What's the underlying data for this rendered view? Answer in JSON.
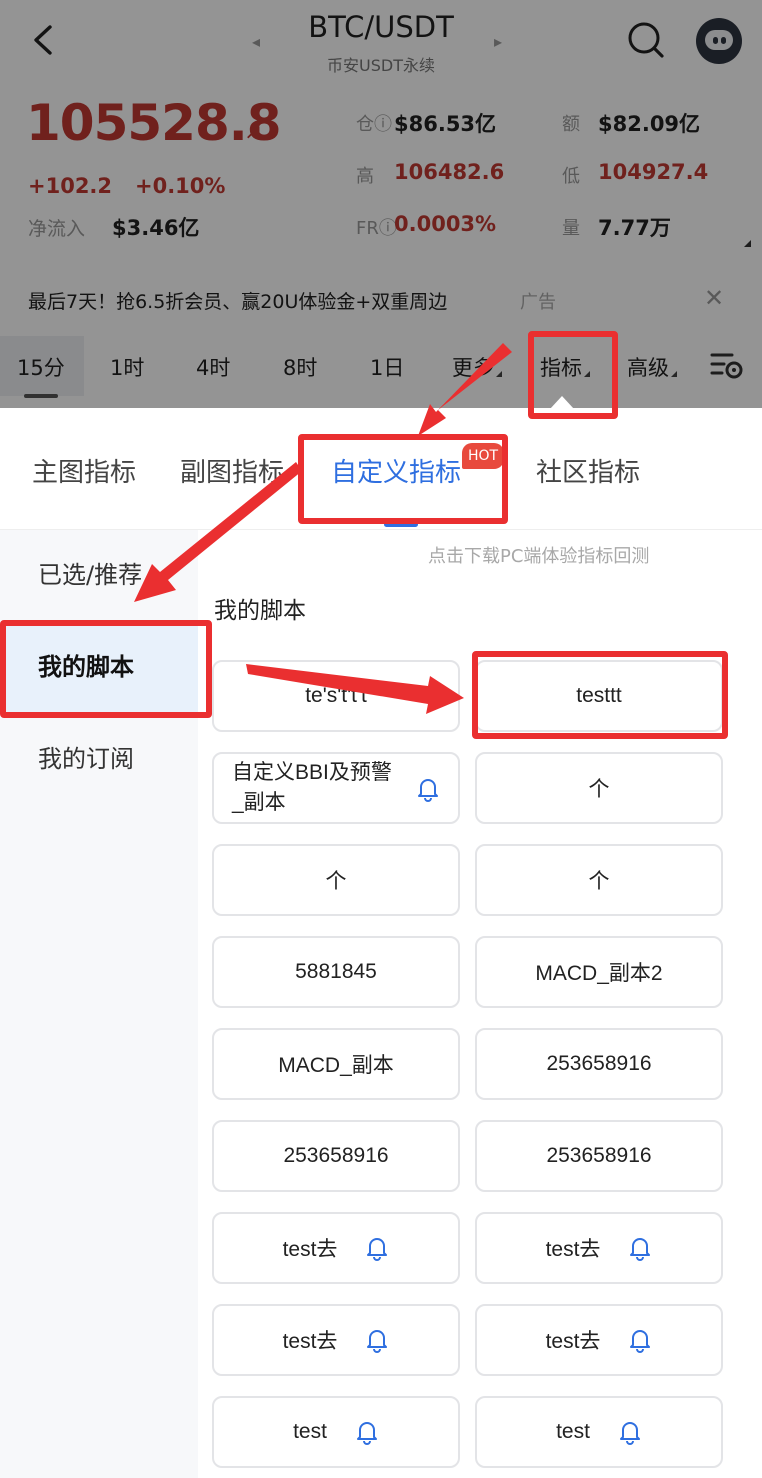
{
  "header": {
    "pair": "BTC/USDT",
    "subtitle": "币安USDT永续",
    "prev_arrow": "◂",
    "next_arrow": "▸"
  },
  "price": {
    "last": "105528.8",
    "arrow": "↗",
    "change_abs": "+102.2",
    "change_pct": "+0.10%",
    "netflow_label": "净流入",
    "netflow_value": "$3.46亿"
  },
  "stats": {
    "oi_label": "仓ⓘ",
    "oi_value": "$86.53亿",
    "vol_amt_label": "额",
    "vol_amt_value": "$82.09亿",
    "high_label": "高",
    "high_value": "106482.6",
    "low_label": "低",
    "low_value": "104927.4",
    "fr_label": "FRⓘ",
    "fr_value": "0.0003%",
    "qty_label": "量",
    "qty_value": "7.77万"
  },
  "ad": {
    "text": "最后7天！抢6.5折会员、赢20U体验金+双重周边",
    "tag": "广告",
    "close": "✕"
  },
  "timeframes": [
    {
      "label": "15分"
    },
    {
      "label": "1时"
    },
    {
      "label": "4时"
    },
    {
      "label": "8时"
    },
    {
      "label": "1日"
    },
    {
      "label": "更多"
    },
    {
      "label": "指标"
    },
    {
      "label": "高级"
    }
  ],
  "panel": {
    "tabs": [
      {
        "label": "主图指标"
      },
      {
        "label": "副图指标"
      },
      {
        "label": "自定义指标"
      },
      {
        "label": "社区指标"
      }
    ],
    "hot_badge": "HOT",
    "hint": "点击下载PC端体验指标回测",
    "section_title": "我的脚本",
    "sidebar": [
      {
        "label": "已选/推荐"
      },
      {
        "label": "我的脚本"
      },
      {
        "label": "我的订阅"
      }
    ],
    "scripts": [
      {
        "label": "te's't't't"
      },
      {
        "label": "testtt"
      },
      {
        "label": "自定义BBI及预警_副本"
      },
      {
        "label": "个"
      },
      {
        "label": "个"
      },
      {
        "label": "个"
      },
      {
        "label": "5881845"
      },
      {
        "label": "MACD_副本2"
      },
      {
        "label": "MACD_副本"
      },
      {
        "label": "253658916"
      },
      {
        "label": "253658916"
      },
      {
        "label": "253658916"
      },
      {
        "label": "test去"
      },
      {
        "label": "test去"
      },
      {
        "label": "test去"
      },
      {
        "label": "test去"
      },
      {
        "label": "test"
      },
      {
        "label": "test"
      }
    ]
  },
  "colors": {
    "accent": "#2f6fe0",
    "price_red": "#c23a33",
    "annotation_red": "#ea2f30",
    "hot_badge": "#e84a3d"
  }
}
